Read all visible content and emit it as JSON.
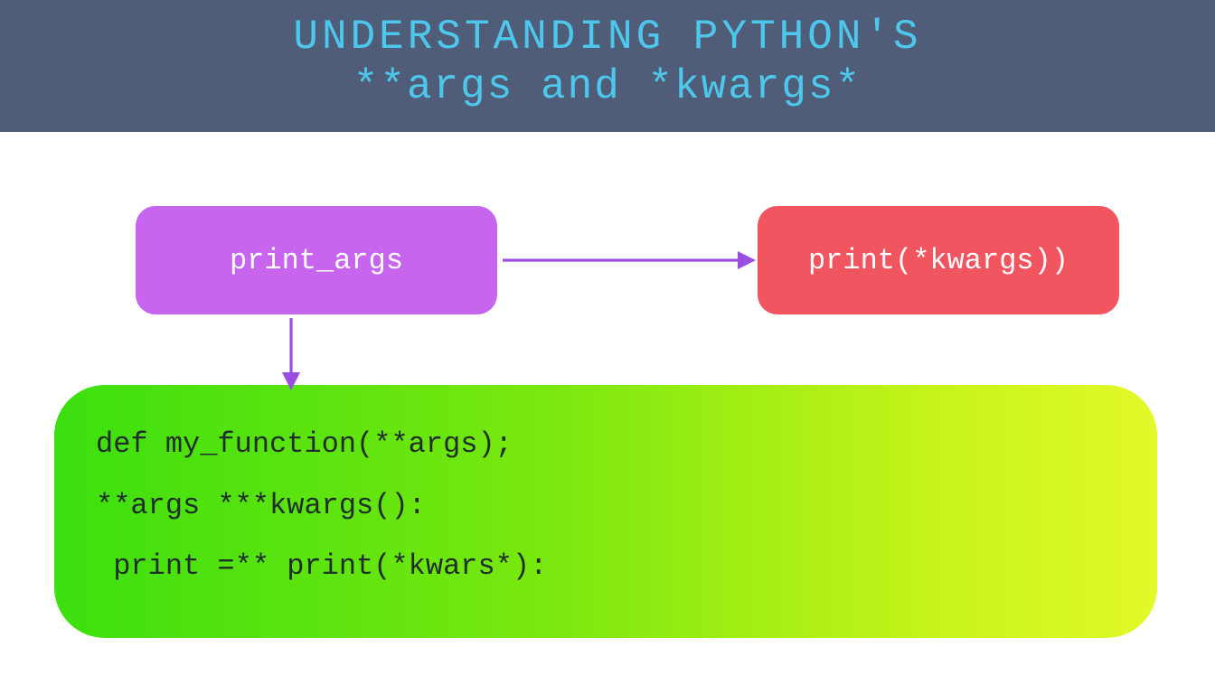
{
  "header": {
    "line1": "UNDERSTANDING PYTHON'S",
    "line2": "**args and *kwargs*"
  },
  "nodes": {
    "purple": {
      "label": "print_args"
    },
    "red": {
      "label": "print(*kwargs))"
    }
  },
  "code": {
    "line1": "def my_function(**args);",
    "line2": "**args ***kwargs():",
    "line3": " print =** print(*kwars*):"
  },
  "colors": {
    "header_bg": "#4f5d78",
    "header_fg": "#4ec7ed",
    "purple": "#c865ee",
    "red": "#f15560",
    "arrow": "#9a4fe0"
  }
}
